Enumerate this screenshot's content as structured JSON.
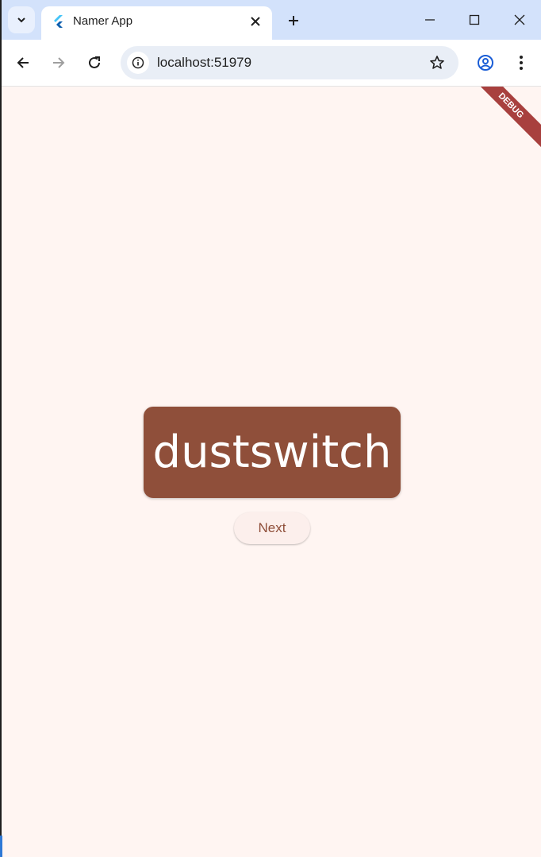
{
  "browser": {
    "tab": {
      "title": "Namer App",
      "favicon": "flutter-icon"
    },
    "address": {
      "url": "localhost:51979"
    },
    "icons": {
      "tab_search": "chevron-down-icon",
      "close_tab": "close-icon",
      "new_tab": "plus-icon",
      "minimize": "minimize-icon",
      "maximize": "maximize-icon",
      "close_window": "close-icon",
      "back": "arrow-left-icon",
      "forward": "arrow-right-icon",
      "reload": "reload-icon",
      "site_info": "info-icon",
      "bookmark": "star-icon",
      "profile": "profile-icon",
      "menu": "more-vert-icon"
    }
  },
  "app": {
    "debug_banner": "DEBUG",
    "word": "dustswitch",
    "next_label": "Next",
    "colors": {
      "background": "#fff5f2",
      "card": "#8f4f3a",
      "card_text": "#ffffff",
      "button_bg": "#fcefec",
      "button_text": "#8f4f3a",
      "debug_banner": "#a8403e"
    }
  }
}
